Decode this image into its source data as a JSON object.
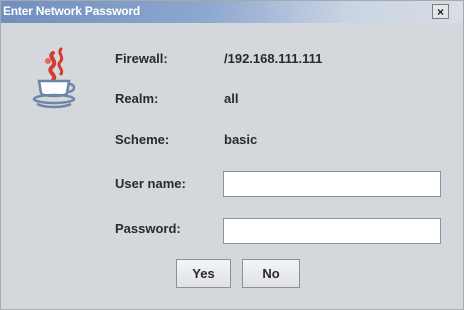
{
  "window": {
    "title": "Enter Network Password",
    "close_glyph": "×"
  },
  "icon": {
    "name": "java-cup-icon"
  },
  "fields": {
    "firewall": {
      "label": "Firewall:",
      "value": "/192.168.111.111"
    },
    "realm": {
      "label": "Realm:",
      "value": "all"
    },
    "scheme": {
      "label": "Scheme:",
      "value": "basic"
    },
    "username": {
      "label": "User name:",
      "value": ""
    },
    "password": {
      "label": "Password:",
      "value": ""
    }
  },
  "buttons": {
    "yes_label": "Yes",
    "no_label": "No"
  },
  "colors": {
    "titlebar_start": "#6f8fbd",
    "dialog_background": "#d4d7dc",
    "icon_red": "#d63a2e",
    "icon_steel": "#6d85a8"
  }
}
